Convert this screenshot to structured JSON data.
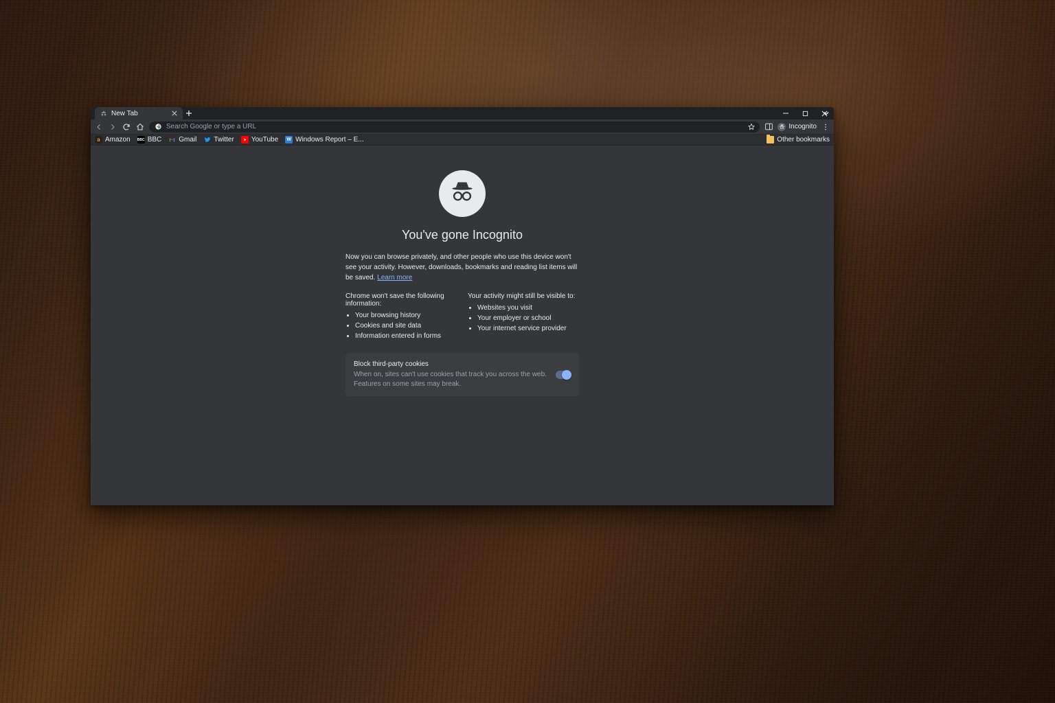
{
  "tab": {
    "title": "New Tab"
  },
  "omnibox": {
    "placeholder": "Search Google or type a URL"
  },
  "chip": {
    "incognito": "Incognito"
  },
  "bookmarks": {
    "items": [
      {
        "label": "Amazon"
      },
      {
        "label": "BBC"
      },
      {
        "label": "Gmail"
      },
      {
        "label": "Twitter"
      },
      {
        "label": "YouTube"
      },
      {
        "label": "Windows Report – E..."
      }
    ],
    "other": "Other bookmarks"
  },
  "page": {
    "title": "You've gone Incognito",
    "desc": "Now you can browse privately, and other people who use this device won't see your activity. However, downloads, bookmarks and reading list items will be saved.",
    "learn": "Learn more",
    "wont_save_hd": "Chrome won't save the following information:",
    "wont_save_items": [
      "Your browsing history",
      "Cookies and site data",
      "Information entered in forms"
    ],
    "visible_hd": "Your activity might still be visible to:",
    "visible_items": [
      "Websites you visit",
      "Your employer or school",
      "Your internet service provider"
    ],
    "cookie_title": "Block third-party cookies",
    "cookie_desc": "When on, sites can't use cookies that track you across the web. Features on some sites may break."
  }
}
